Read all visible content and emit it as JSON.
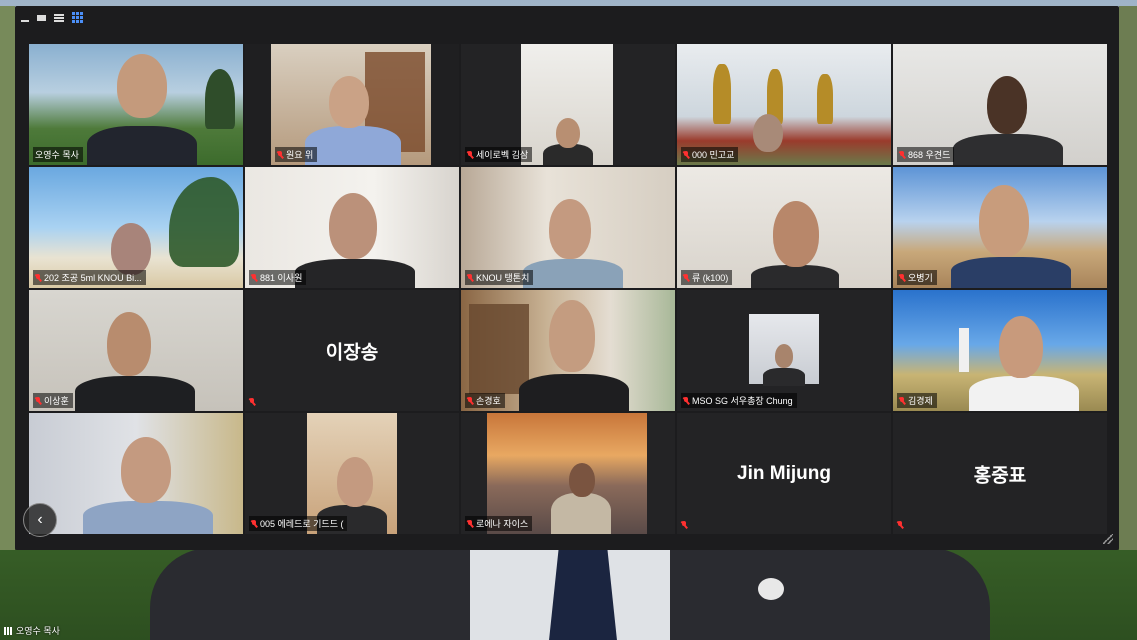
{
  "app": {
    "name": "Zoom Gallery View"
  },
  "speaker": {
    "name": "오영수 목사"
  },
  "colors": {
    "active_border": "#d8c84a",
    "muted_icon": "#ff3030",
    "grid_icon": "#4b8ff7",
    "tile_bg": "#232325"
  },
  "tiles": [
    {
      "label": "오영수 목사",
      "muted": false
    },
    {
      "label": "원요 위",
      "muted": true
    },
    {
      "label": "세이로벡 김삼",
      "muted": true
    },
    {
      "label": "000 민고교",
      "muted": true
    },
    {
      "label": "868 우견드",
      "muted": true
    },
    {
      "label": "202 조공 5ml KNOU Bi...",
      "muted": true
    },
    {
      "label": "881 이사원",
      "muted": true
    },
    {
      "label": "KNOU 탱톤치",
      "muted": true
    },
    {
      "label": "류 (k100)",
      "muted": true
    },
    {
      "label": "오병기",
      "muted": true
    },
    {
      "label": "이상훈",
      "muted": true
    },
    {
      "label": "이장송",
      "muted": true
    },
    {
      "label": "손경호",
      "muted": true
    },
    {
      "label": "MSO SG 서우총장 Chung",
      "muted": true
    },
    {
      "label": "김경제",
      "muted": true
    },
    {
      "label": "",
      "muted": false
    },
    {
      "label": "005 에레드로 기드드 (",
      "muted": true
    },
    {
      "label": "로에나 자이스",
      "muted": true
    },
    {
      "label": "Jin Mijung",
      "muted": true
    },
    {
      "label": "홍중표",
      "muted": true
    }
  ]
}
